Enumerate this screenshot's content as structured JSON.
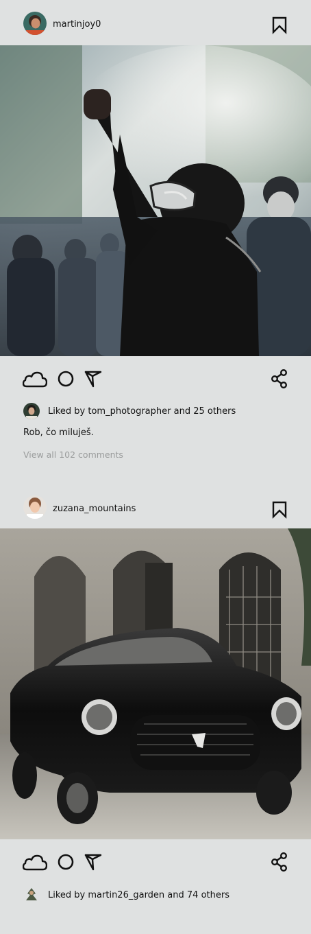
{
  "posts": [
    {
      "username": "martinjoy0",
      "likes_text": "Liked by tom_photographer and 25 others",
      "caption": "Rob, čo miluješ.",
      "view_comments": "View all 102 comments",
      "icons": [
        "bookmark-icon",
        "heart-icon",
        "comment-icon",
        "send-icon",
        "share-icon"
      ]
    },
    {
      "username": "zuzana_mountains",
      "likes_text": "Liked by martin26_garden and 74 others",
      "icons": [
        "bookmark-icon",
        "heart-icon",
        "comment-icon",
        "send-icon",
        "share-icon"
      ]
    }
  ]
}
